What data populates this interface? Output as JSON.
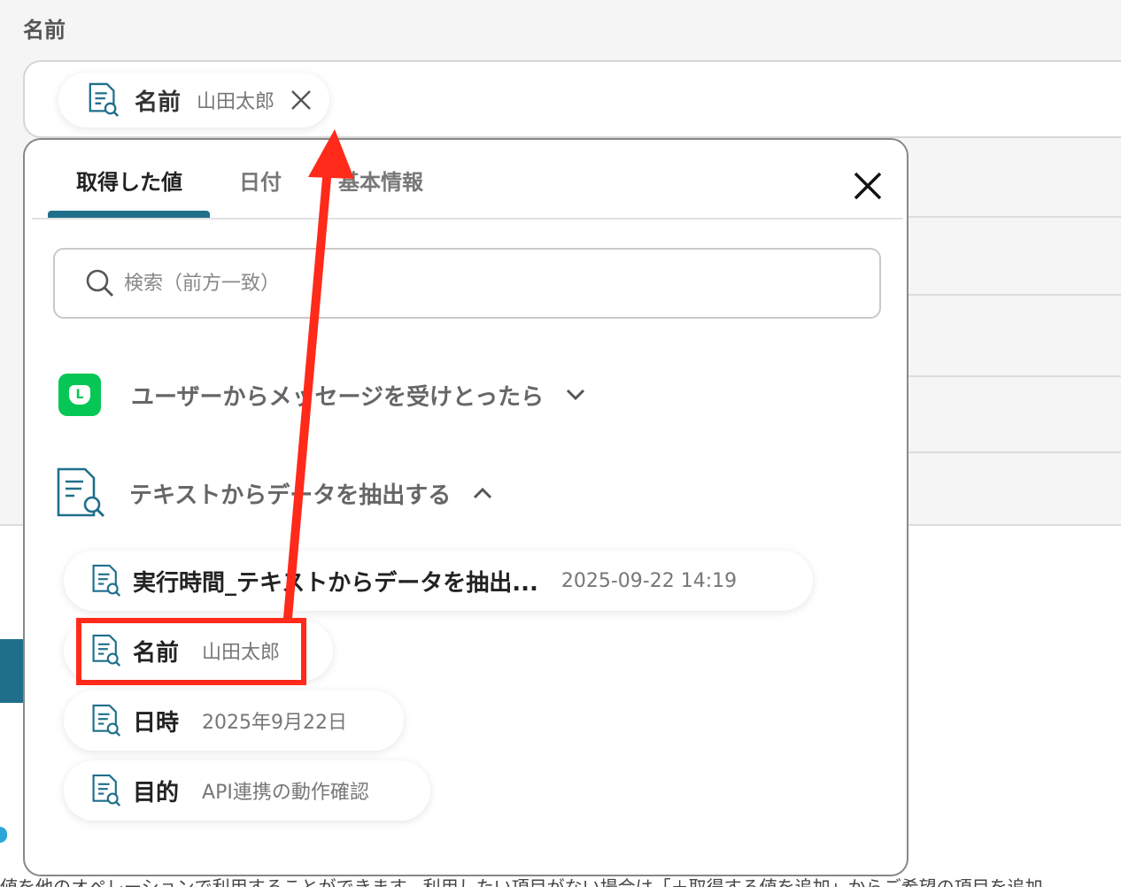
{
  "field": {
    "label": "名前",
    "chip": {
      "key": "名前",
      "value": "山田太郎"
    }
  },
  "tabs": [
    {
      "label": "取得した値",
      "active": true
    },
    {
      "label": "日付",
      "active": false
    },
    {
      "label": "基本情報",
      "active": false
    }
  ],
  "search": {
    "placeholder": "検索（前方一致）"
  },
  "sections": [
    {
      "title": "ユーザーからメッセージを受けとったら",
      "icon": "line-app-icon",
      "expanded": false
    },
    {
      "title": "テキストからデータを抽出する",
      "icon": "document-search-icon",
      "expanded": true
    }
  ],
  "items": [
    {
      "key": "実行時間_テキストからデータを抽出...",
      "value": "2025-09-22 14:19"
    },
    {
      "key": "名前",
      "value": "山田太郎",
      "highlighted": true
    },
    {
      "key": "日時",
      "value": "2025年9月22日"
    },
    {
      "key": "目的",
      "value": "API連携の動作確認"
    }
  ],
  "footer": {
    "text": "値を他のオペレーションで利用することができます。利用したい項目がない場合は「＋取得する値を追加」からご希望の項目を追加"
  },
  "colors": {
    "accent": "#1f6f8b",
    "highlight": "#ff2a1a",
    "line_green": "#06c755"
  }
}
